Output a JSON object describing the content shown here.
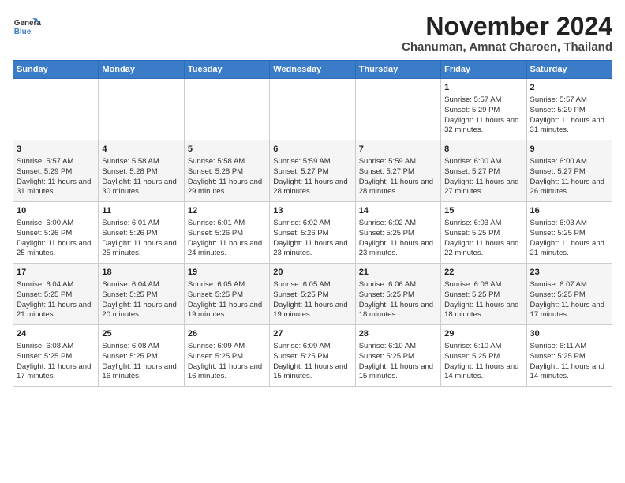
{
  "header": {
    "logo_line1": "General",
    "logo_line2": "Blue",
    "month": "November 2024",
    "location": "Chanuman, Amnat Charoen, Thailand"
  },
  "weekdays": [
    "Sunday",
    "Monday",
    "Tuesday",
    "Wednesday",
    "Thursday",
    "Friday",
    "Saturday"
  ],
  "weeks": [
    [
      {
        "day": "",
        "sunrise": "",
        "sunset": "",
        "daylight": ""
      },
      {
        "day": "",
        "sunrise": "",
        "sunset": "",
        "daylight": ""
      },
      {
        "day": "",
        "sunrise": "",
        "sunset": "",
        "daylight": ""
      },
      {
        "day": "",
        "sunrise": "",
        "sunset": "",
        "daylight": ""
      },
      {
        "day": "",
        "sunrise": "",
        "sunset": "",
        "daylight": ""
      },
      {
        "day": "1",
        "sunrise": "Sunrise: 5:57 AM",
        "sunset": "Sunset: 5:29 PM",
        "daylight": "Daylight: 11 hours and 32 minutes."
      },
      {
        "day": "2",
        "sunrise": "Sunrise: 5:57 AM",
        "sunset": "Sunset: 5:29 PM",
        "daylight": "Daylight: 11 hours and 31 minutes."
      }
    ],
    [
      {
        "day": "3",
        "sunrise": "Sunrise: 5:57 AM",
        "sunset": "Sunset: 5:29 PM",
        "daylight": "Daylight: 11 hours and 31 minutes."
      },
      {
        "day": "4",
        "sunrise": "Sunrise: 5:58 AM",
        "sunset": "Sunset: 5:28 PM",
        "daylight": "Daylight: 11 hours and 30 minutes."
      },
      {
        "day": "5",
        "sunrise": "Sunrise: 5:58 AM",
        "sunset": "Sunset: 5:28 PM",
        "daylight": "Daylight: 11 hours and 29 minutes."
      },
      {
        "day": "6",
        "sunrise": "Sunrise: 5:59 AM",
        "sunset": "Sunset: 5:27 PM",
        "daylight": "Daylight: 11 hours and 28 minutes."
      },
      {
        "day": "7",
        "sunrise": "Sunrise: 5:59 AM",
        "sunset": "Sunset: 5:27 PM",
        "daylight": "Daylight: 11 hours and 28 minutes."
      },
      {
        "day": "8",
        "sunrise": "Sunrise: 6:00 AM",
        "sunset": "Sunset: 5:27 PM",
        "daylight": "Daylight: 11 hours and 27 minutes."
      },
      {
        "day": "9",
        "sunrise": "Sunrise: 6:00 AM",
        "sunset": "Sunset: 5:27 PM",
        "daylight": "Daylight: 11 hours and 26 minutes."
      }
    ],
    [
      {
        "day": "10",
        "sunrise": "Sunrise: 6:00 AM",
        "sunset": "Sunset: 5:26 PM",
        "daylight": "Daylight: 11 hours and 25 minutes."
      },
      {
        "day": "11",
        "sunrise": "Sunrise: 6:01 AM",
        "sunset": "Sunset: 5:26 PM",
        "daylight": "Daylight: 11 hours and 25 minutes."
      },
      {
        "day": "12",
        "sunrise": "Sunrise: 6:01 AM",
        "sunset": "Sunset: 5:26 PM",
        "daylight": "Daylight: 11 hours and 24 minutes."
      },
      {
        "day": "13",
        "sunrise": "Sunrise: 6:02 AM",
        "sunset": "Sunset: 5:26 PM",
        "daylight": "Daylight: 11 hours and 23 minutes."
      },
      {
        "day": "14",
        "sunrise": "Sunrise: 6:02 AM",
        "sunset": "Sunset: 5:25 PM",
        "daylight": "Daylight: 11 hours and 23 minutes."
      },
      {
        "day": "15",
        "sunrise": "Sunrise: 6:03 AM",
        "sunset": "Sunset: 5:25 PM",
        "daylight": "Daylight: 11 hours and 22 minutes."
      },
      {
        "day": "16",
        "sunrise": "Sunrise: 6:03 AM",
        "sunset": "Sunset: 5:25 PM",
        "daylight": "Daylight: 11 hours and 21 minutes."
      }
    ],
    [
      {
        "day": "17",
        "sunrise": "Sunrise: 6:04 AM",
        "sunset": "Sunset: 5:25 PM",
        "daylight": "Daylight: 11 hours and 21 minutes."
      },
      {
        "day": "18",
        "sunrise": "Sunrise: 6:04 AM",
        "sunset": "Sunset: 5:25 PM",
        "daylight": "Daylight: 11 hours and 20 minutes."
      },
      {
        "day": "19",
        "sunrise": "Sunrise: 6:05 AM",
        "sunset": "Sunset: 5:25 PM",
        "daylight": "Daylight: 11 hours and 19 minutes."
      },
      {
        "day": "20",
        "sunrise": "Sunrise: 6:05 AM",
        "sunset": "Sunset: 5:25 PM",
        "daylight": "Daylight: 11 hours and 19 minutes."
      },
      {
        "day": "21",
        "sunrise": "Sunrise: 6:06 AM",
        "sunset": "Sunset: 5:25 PM",
        "daylight": "Daylight: 11 hours and 18 minutes."
      },
      {
        "day": "22",
        "sunrise": "Sunrise: 6:06 AM",
        "sunset": "Sunset: 5:25 PM",
        "daylight": "Daylight: 11 hours and 18 minutes."
      },
      {
        "day": "23",
        "sunrise": "Sunrise: 6:07 AM",
        "sunset": "Sunset: 5:25 PM",
        "daylight": "Daylight: 11 hours and 17 minutes."
      }
    ],
    [
      {
        "day": "24",
        "sunrise": "Sunrise: 6:08 AM",
        "sunset": "Sunset: 5:25 PM",
        "daylight": "Daylight: 11 hours and 17 minutes."
      },
      {
        "day": "25",
        "sunrise": "Sunrise: 6:08 AM",
        "sunset": "Sunset: 5:25 PM",
        "daylight": "Daylight: 11 hours and 16 minutes."
      },
      {
        "day": "26",
        "sunrise": "Sunrise: 6:09 AM",
        "sunset": "Sunset: 5:25 PM",
        "daylight": "Daylight: 11 hours and 16 minutes."
      },
      {
        "day": "27",
        "sunrise": "Sunrise: 6:09 AM",
        "sunset": "Sunset: 5:25 PM",
        "daylight": "Daylight: 11 hours and 15 minutes."
      },
      {
        "day": "28",
        "sunrise": "Sunrise: 6:10 AM",
        "sunset": "Sunset: 5:25 PM",
        "daylight": "Daylight: 11 hours and 15 minutes."
      },
      {
        "day": "29",
        "sunrise": "Sunrise: 6:10 AM",
        "sunset": "Sunset: 5:25 PM",
        "daylight": "Daylight: 11 hours and 14 minutes."
      },
      {
        "day": "30",
        "sunrise": "Sunrise: 6:11 AM",
        "sunset": "Sunset: 5:25 PM",
        "daylight": "Daylight: 11 hours and 14 minutes."
      }
    ]
  ]
}
